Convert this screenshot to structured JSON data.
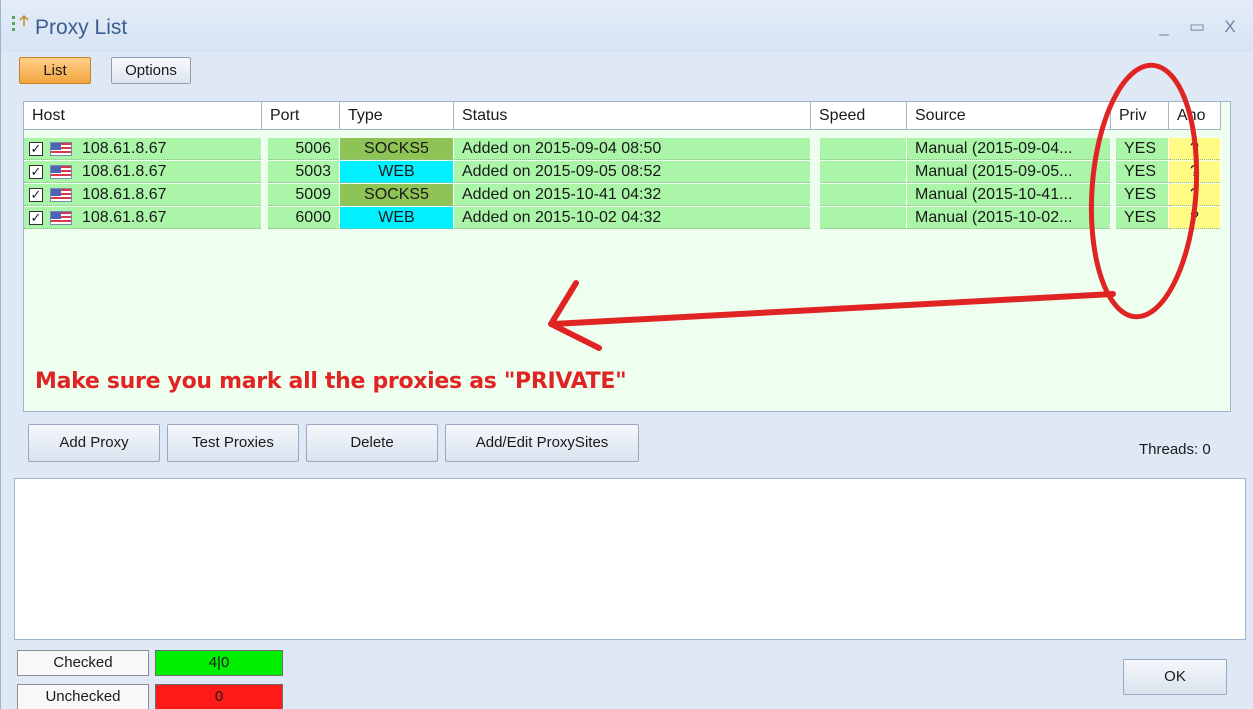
{
  "window": {
    "title": "Proxy List",
    "controls": {
      "minimize": "_",
      "maximize": "▭",
      "close": "X"
    }
  },
  "tabs": [
    {
      "label": "List",
      "active": true
    },
    {
      "label": "Options",
      "active": false
    }
  ],
  "table": {
    "columns": [
      "Host",
      "Port",
      "Type",
      "Status",
      "Speed",
      "Source",
      "Priv",
      "Ano"
    ],
    "rows": [
      {
        "checked": true,
        "flag": "us-flag-icon",
        "host": "108.61.8.67",
        "port": "5006",
        "type": "SOCKS5",
        "status": "Added on 2015-09-04 08:50",
        "speed": "",
        "source": "Manual (2015-09-04...",
        "priv": "YES",
        "ano": "?"
      },
      {
        "checked": true,
        "flag": "us-flag-icon",
        "host": "108.61.8.67",
        "port": "5003",
        "type": "WEB",
        "status": "Added on 2015-09-05 08:52",
        "speed": "",
        "source": "Manual (2015-09-05...",
        "priv": "YES",
        "ano": "?"
      },
      {
        "checked": true,
        "flag": "us-flag-icon",
        "host": "108.61.8.67",
        "port": "5009",
        "type": "SOCKS5",
        "status": "Added on 2015-10-41 04:32",
        "speed": "",
        "source": "Manual (2015-10-41...",
        "priv": "YES",
        "ano": "?"
      },
      {
        "checked": true,
        "flag": "us-flag-icon",
        "host": "108.61.8.67",
        "port": "6000",
        "type": "WEB",
        "status": "Added on 2015-10-02 04:32",
        "speed": "",
        "source": "Manual (2015-10-02...",
        "priv": "YES",
        "ano": "?"
      }
    ]
  },
  "annotation": {
    "text": "Make sure you mark all the proxies as \"PRIVATE\"",
    "color": "#e02424"
  },
  "buttons": {
    "add_proxy": "Add Proxy",
    "test_proxies": "Test Proxies",
    "delete": "Delete",
    "add_edit_proxysites": "Add/Edit ProxySites",
    "ok": "OK"
  },
  "threads": "Threads: 0",
  "stats": {
    "checked_label": "Checked",
    "checked_value": "4|0",
    "checked_color": "#00ee00",
    "unchecked_label": "Unchecked",
    "unchecked_value": "0",
    "unchecked_color": "#ff1a1a"
  },
  "colors": {
    "row_green": "#aaf5a7",
    "socks5": "#8ec456",
    "web": "#00f0ff",
    "ano": "#fffb85",
    "tab_active": "#f3a43e"
  }
}
